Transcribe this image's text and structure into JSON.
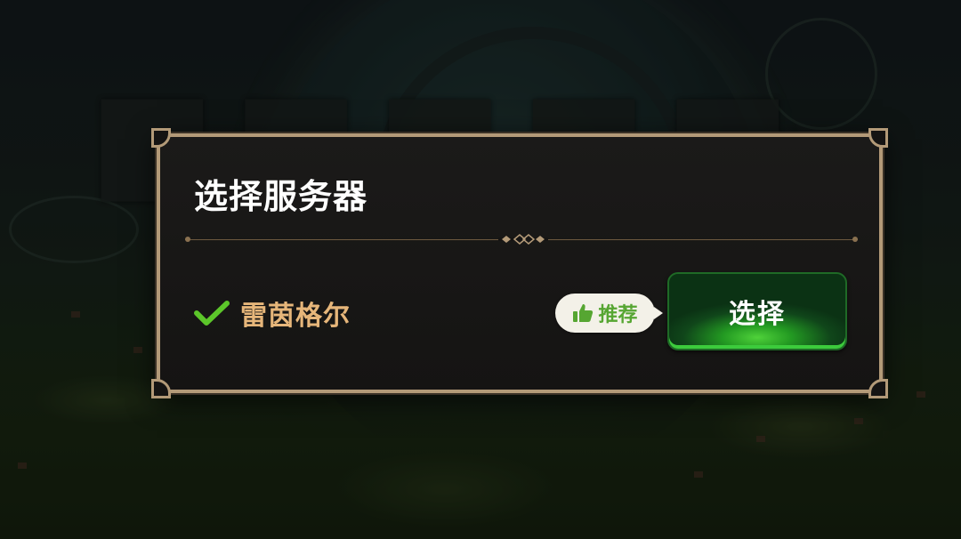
{
  "dialog": {
    "title": "选择服务器",
    "server": {
      "name": "雷茵格尔",
      "selected": true,
      "check_icon": "check-icon"
    },
    "recommend_badge": {
      "label": "推荐",
      "icon": "thumbs-up-icon"
    },
    "select_button": {
      "label": "选择"
    }
  },
  "colors": {
    "frame": "#b39a78",
    "server_name": "#e6b67a",
    "check": "#5cc62a",
    "recommend_text": "#56a632",
    "button_green": "#239a22"
  }
}
